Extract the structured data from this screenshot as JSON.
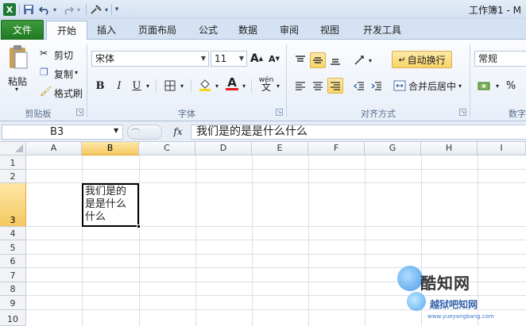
{
  "window": {
    "title": "工作簿1 - M"
  },
  "quick_access": {
    "save_icon": "save-icon",
    "undo_icon": "undo-icon",
    "redo_icon": "redo-icon",
    "custom_icon": "brush-icon"
  },
  "tabs": [
    {
      "label": "文件"
    },
    {
      "label": "开始"
    },
    {
      "label": "插入"
    },
    {
      "label": "页面布局"
    },
    {
      "label": "公式"
    },
    {
      "label": "数据"
    },
    {
      "label": "审阅"
    },
    {
      "label": "视图"
    },
    {
      "label": "开发工具"
    }
  ],
  "clipboard": {
    "paste": "粘贴",
    "cut": "剪切",
    "copy": "复制",
    "format_painter": "格式刷",
    "group": "剪贴板"
  },
  "font": {
    "name": "宋体",
    "size": "11",
    "bold": "B",
    "italic": "I",
    "underline": "U",
    "grow": "A",
    "shrink": "A",
    "color_letter": "A",
    "phonetic": "wén",
    "group": "字体"
  },
  "alignment": {
    "wrap": "自动换行",
    "merge": "合并后居中",
    "group": "对齐方式"
  },
  "number": {
    "format": "常规",
    "percent": "%",
    "group": "数字"
  },
  "formula": {
    "name_box": "B3",
    "fx": "fx",
    "content": "我们是的是是什么什么"
  },
  "columns": [
    "A",
    "B",
    "C",
    "D",
    "E",
    "F",
    "G",
    "H",
    "I"
  ],
  "rows": [
    "1",
    "2",
    "3",
    "4",
    "5",
    "6",
    "7",
    "8",
    "9",
    "10"
  ],
  "cells": {
    "B3": "我们是的是是什么什么"
  },
  "watermark": {
    "line1": "酷知网",
    "line2": "越狱吧知网",
    "line3": "www.yueyangbang.com"
  },
  "colors": {
    "file_tab": "#217a22",
    "selection_header": "#f5c860",
    "ribbon_bg": "#e7eef8"
  }
}
